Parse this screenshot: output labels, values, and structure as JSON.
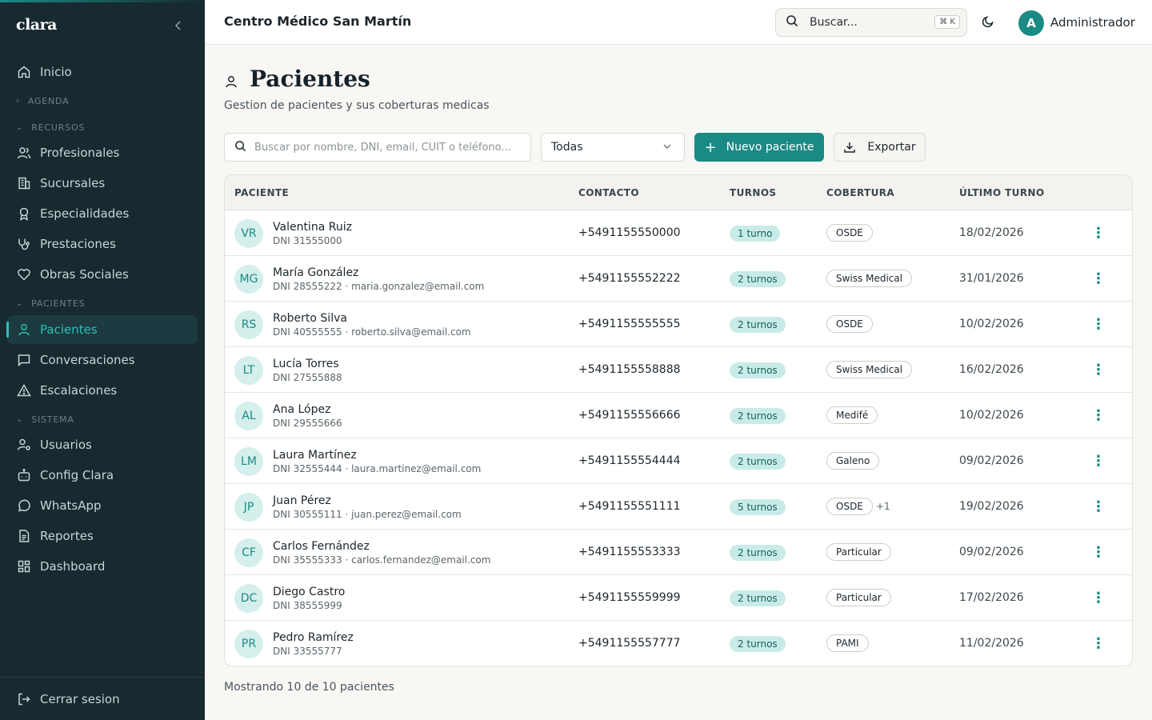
{
  "sidebar": {
    "brand": "clara",
    "items": {
      "inicio": "Inicio",
      "profesionales": "Profesionales",
      "sucursales": "Sucursales",
      "especialidades": "Especialidades",
      "prestaciones": "Prestaciones",
      "obras_sociales": "Obras Sociales",
      "pacientes": "Pacientes",
      "conversaciones": "Conversaciones",
      "escalaciones": "Escalaciones",
      "usuarios": "Usuarios",
      "config_clara": "Config Clara",
      "whatsapp": "WhatsApp",
      "reportes": "Reportes",
      "dashboard": "Dashboard"
    },
    "sections": {
      "agenda": "AGENDA",
      "recursos": "RECURSOS",
      "pacientes": "PACIENTES",
      "sistema": "SISTEMA"
    },
    "logout": "Cerrar sesion"
  },
  "header": {
    "org": "Centro Médico San Martín",
    "search_label": "Buscar...",
    "shortcut": "⌘ K",
    "user_initial": "A",
    "user_name": "Administrador"
  },
  "page": {
    "title": "Pacientes",
    "subtitle": "Gestion de pacientes y sus coberturas medicas",
    "search_placeholder": "Buscar por nombre, DNI, email, CUIT o teléfono...",
    "filter_value": "Todas",
    "new_button": "Nuevo paciente",
    "export_button": "Exportar",
    "footer": "Mostrando 10 de 10 pacientes"
  },
  "table": {
    "headers": {
      "paciente": "PACIENTE",
      "contacto": "CONTACTO",
      "turnos": "TURNOS",
      "cobertura": "COBERTURA",
      "ultimo": "ÚLTIMO TURNO"
    },
    "rows": [
      {
        "initials": "VR",
        "name": "Valentina Ruiz",
        "sub": "DNI 31555000",
        "phone": "+5491155550000",
        "turnos": "1 turno",
        "cobertura": "OSDE",
        "extra": "",
        "last": "18/02/2026"
      },
      {
        "initials": "MG",
        "name": "María González",
        "sub": "DNI 28555222 · maria.gonzalez@email.com",
        "phone": "+5491155552222",
        "turnos": "2 turnos",
        "cobertura": "Swiss Medical",
        "extra": "",
        "last": "31/01/2026"
      },
      {
        "initials": "RS",
        "name": "Roberto Silva",
        "sub": "DNI 40555555 · roberto.silva@email.com",
        "phone": "+5491155555555",
        "turnos": "2 turnos",
        "cobertura": "OSDE",
        "extra": "",
        "last": "10/02/2026"
      },
      {
        "initials": "LT",
        "name": "Lucía Torres",
        "sub": "DNI 27555888",
        "phone": "+5491155558888",
        "turnos": "2 turnos",
        "cobertura": "Swiss Medical",
        "extra": "",
        "last": "16/02/2026"
      },
      {
        "initials": "AL",
        "name": "Ana López",
        "sub": "DNI 29555666",
        "phone": "+5491155556666",
        "turnos": "2 turnos",
        "cobertura": "Medifé",
        "extra": "",
        "last": "10/02/2026"
      },
      {
        "initials": "LM",
        "name": "Laura Martínez",
        "sub": "DNI 32555444 · laura.martinez@email.com",
        "phone": "+5491155554444",
        "turnos": "2 turnos",
        "cobertura": "Galeno",
        "extra": "",
        "last": "09/02/2026"
      },
      {
        "initials": "JP",
        "name": "Juan Pérez",
        "sub": "DNI 30555111 · juan.perez@email.com",
        "phone": "+5491155551111",
        "turnos": "5 turnos",
        "cobertura": "OSDE",
        "extra": "+1",
        "last": "19/02/2026"
      },
      {
        "initials": "CF",
        "name": "Carlos Fernández",
        "sub": "DNI 35555333 · carlos.fernandez@email.com",
        "phone": "+5491155553333",
        "turnos": "2 turnos",
        "cobertura": "Particular",
        "extra": "",
        "last": "09/02/2026"
      },
      {
        "initials": "DC",
        "name": "Diego Castro",
        "sub": "DNI 38555999",
        "phone": "+5491155559999",
        "turnos": "2 turnos",
        "cobertura": "Particular",
        "extra": "",
        "last": "17/02/2026"
      },
      {
        "initials": "PR",
        "name": "Pedro Ramírez",
        "sub": "DNI 33555777",
        "phone": "+5491155557777",
        "turnos": "2 turnos",
        "cobertura": "PAMI",
        "extra": "",
        "last": "11/02/2026"
      }
    ]
  },
  "colors": {
    "sidebar_bg": "#172a30",
    "accent": "#1a8a84",
    "active_text": "#2bc0b5",
    "page_bg": "#f8f7f4"
  }
}
